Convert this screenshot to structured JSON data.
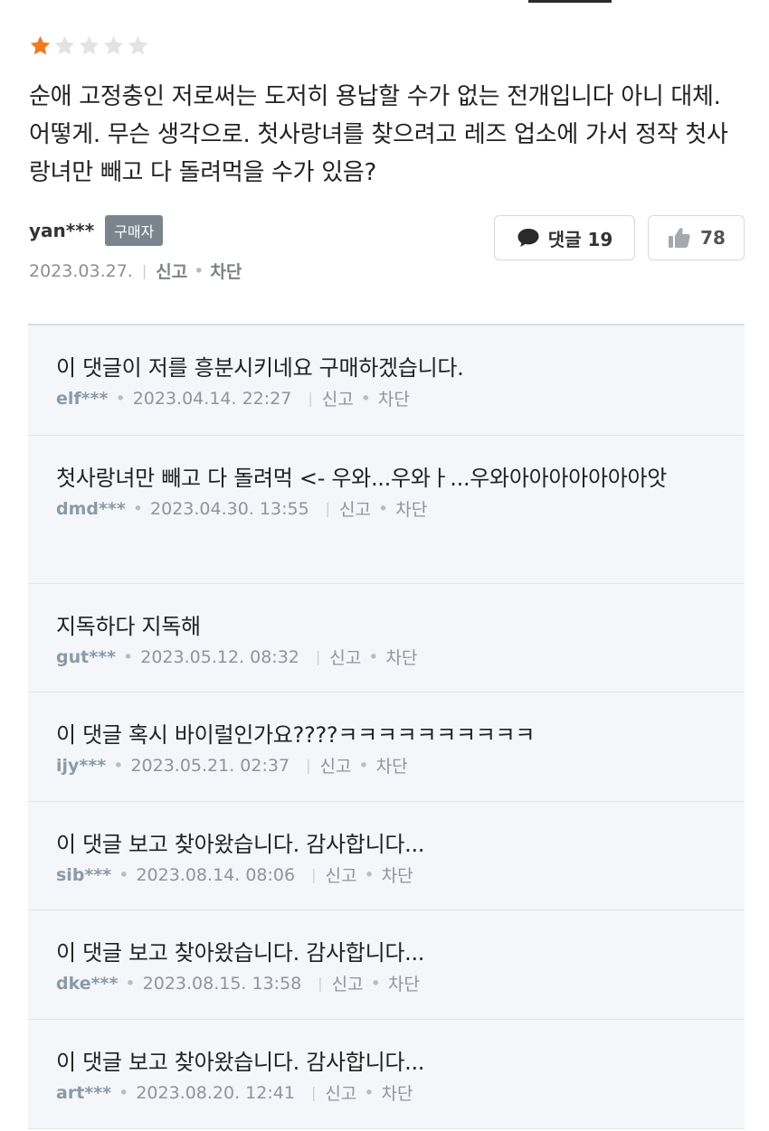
{
  "review": {
    "rating": 1,
    "max_rating": 5,
    "star_color_filled": "#f07b22",
    "star_color_empty": "#e3e3e3",
    "text": "순애 고정충인 저로써는 도저히 용납할 수가 없는 전개입니다 아니 대체. 어떻게. 무슨 생각으로. 첫사랑녀를 찾으려고 레즈 업소에 가서 정작 첫사랑녀만 빼고 다 돌려먹을 수가 있음?",
    "author": "yan***",
    "badge": "구매자",
    "date": "2023.03.27.",
    "report_label": "신고",
    "block_label": "차단",
    "comments_button_label": "댓글 19",
    "like_count": "78",
    "icons": {
      "comments": "speech-bubble-icon",
      "like": "thumbs-up-icon"
    }
  },
  "comments": [
    {
      "text": "이 댓글이 저를 흥분시키네요 구매하겠습니다.",
      "user": "elf***",
      "datetime": "2023.04.14. 22:27",
      "report": "신고",
      "block": "차단"
    },
    {
      "text": "첫사랑녀만 빼고 다 돌려먹 <- 우와...우와ㅏ...우와아아아아아아아앗",
      "user": "dmd***",
      "datetime": "2023.04.30. 13:55",
      "report": "신고",
      "block": "차단"
    },
    {
      "text": "지독하다 지독해",
      "user": "gut***",
      "datetime": "2023.05.12. 08:32",
      "report": "신고",
      "block": "차단"
    },
    {
      "text": "이 댓글 혹시 바이럴인가요????ㅋㅋㅋㅋㅋㅋㅋㅋㅋㅋ",
      "user": "ijy***",
      "datetime": "2023.05.21. 02:37",
      "report": "신고",
      "block": "차단"
    },
    {
      "text": "이 댓글 보고 찾아왔습니다. 감사합니다...",
      "user": "sib***",
      "datetime": "2023.08.14. 08:06",
      "report": "신고",
      "block": "차단"
    },
    {
      "text": "이 댓글 보고 찾아왔습니다. 감사합니다...",
      "user": "dke***",
      "datetime": "2023.08.15. 13:58",
      "report": "신고",
      "block": "차단"
    },
    {
      "text": "이 댓글 보고 찾아왔습니다. 감사합니다...",
      "user": "art***",
      "datetime": "2023.08.20. 12:41",
      "report": "신고",
      "block": "차단"
    }
  ]
}
